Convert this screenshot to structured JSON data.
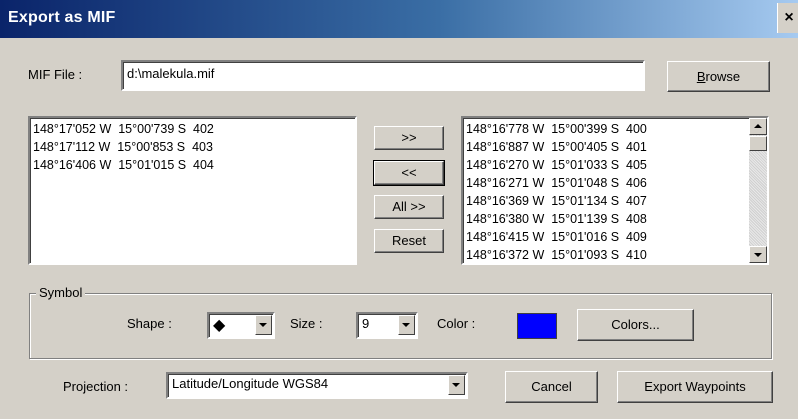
{
  "window": {
    "title": "Export as MIF",
    "close_glyph": "×"
  },
  "mif_file": {
    "label": "MIF File :",
    "value": "d:\\malekula.mif",
    "browse_label_u": "B",
    "browse_label_rest": "rowse"
  },
  "left_list": {
    "rows": [
      "148°17'052 W  15°00'739 S  402",
      "148°17'112 W  15°00'853 S  403",
      "148°16'406 W  15°01'015 S  404"
    ]
  },
  "transfer": {
    "add": ">>",
    "remove": "<<",
    "all": "All >>",
    "reset": "Reset"
  },
  "right_list": {
    "rows": [
      "148°16'778 W  15°00'399 S  400",
      "148°16'887 W  15°00'405 S  401",
      "148°16'270 W  15°01'033 S  405",
      "148°16'271 W  15°01'048 S  406",
      "148°16'369 W  15°01'134 S  407",
      "148°16'380 W  15°01'139 S  408",
      "148°16'415 W  15°01'016 S  409",
      "148°16'372 W  15°01'093 S  410"
    ]
  },
  "symbol": {
    "group_label": "Symbol",
    "shape_label": "Shape :",
    "shape_value": "◆",
    "size_label": "Size :",
    "size_value": "9",
    "color_label": "Color :",
    "color_value": "#0000ff",
    "colors_button": "Colors..."
  },
  "projection": {
    "label": "Projection :",
    "value": "Latitude/Longitude WGS84"
  },
  "footer": {
    "cancel": "Cancel",
    "export": "Export Waypoints"
  }
}
